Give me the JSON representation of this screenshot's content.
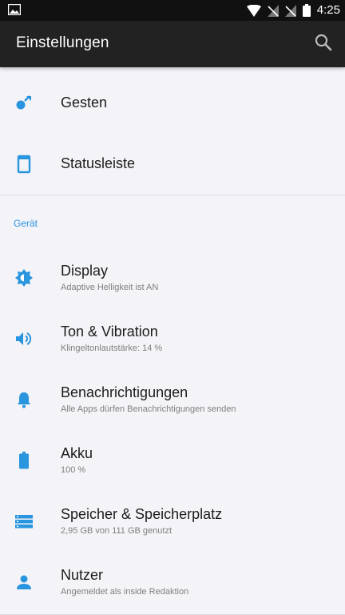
{
  "colors": {
    "accent": "#2a95df",
    "appbar": "#222222",
    "statusbar": "#111111",
    "background": "#f4f3f7"
  },
  "status_bar": {
    "time": "4:25",
    "icons": [
      "image-icon",
      "wifi-icon",
      "no-sim-icon",
      "no-sim-icon",
      "battery-icon"
    ]
  },
  "app_bar": {
    "title": "Einstellungen",
    "search_icon": "search-icon"
  },
  "top_items": [
    {
      "icon": "gesture-icon",
      "label": "Gesten"
    },
    {
      "icon": "statusbar-icon",
      "label": "Statusleiste"
    }
  ],
  "section": {
    "header": "Gerät"
  },
  "device_items": [
    {
      "icon": "brightness-icon",
      "label": "Display",
      "subtitle": "Adaptive Helligkeit ist AN"
    },
    {
      "icon": "volume-icon",
      "label": "Ton & Vibration",
      "subtitle": "Klingeltonlautstärke: 14 %"
    },
    {
      "icon": "bell-icon",
      "label": "Benachrichtigungen",
      "subtitle": "Alle Apps dürfen Benachrichtigungen senden"
    },
    {
      "icon": "battery-icon",
      "label": "Akku",
      "subtitle": "100 %"
    },
    {
      "icon": "storage-icon",
      "label": "Speicher & Speicherplatz",
      "subtitle": "2,95 GB von 111 GB genutzt"
    },
    {
      "icon": "user-icon",
      "label": "Nutzer",
      "subtitle": "Angemeldet als inside Redaktion"
    }
  ]
}
